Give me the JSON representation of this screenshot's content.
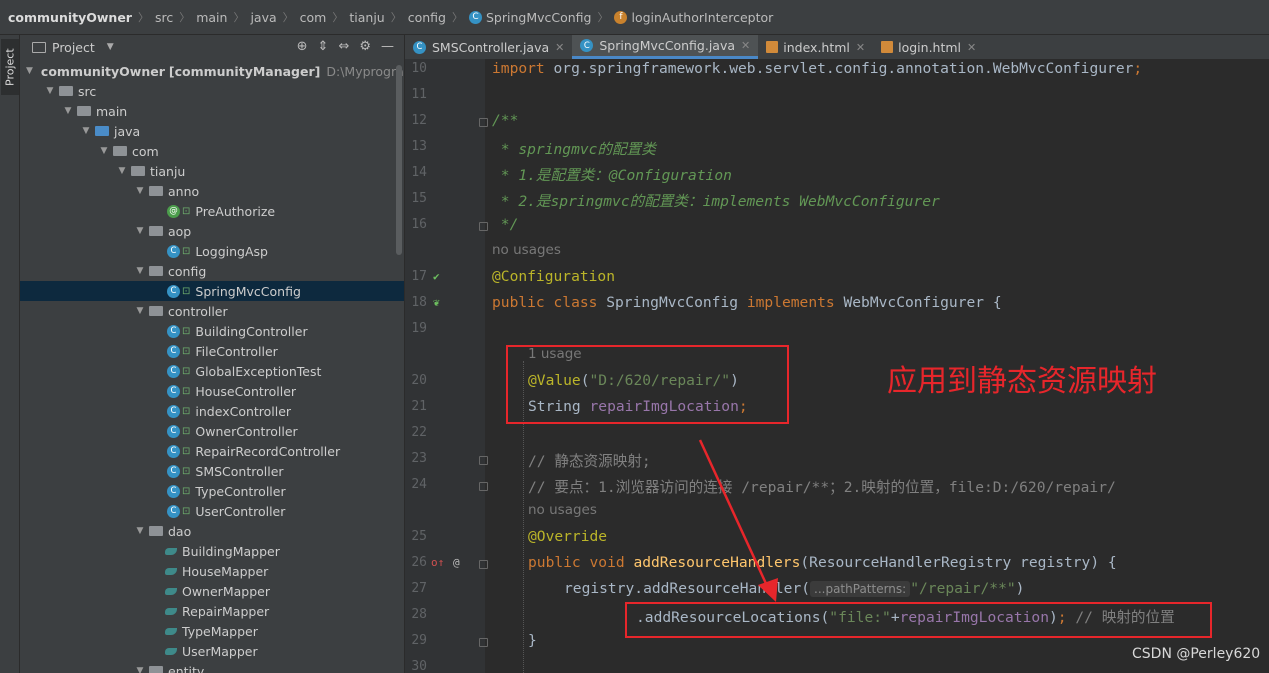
{
  "breadcrumb": {
    "items": [
      "communityOwner",
      "src",
      "main",
      "java",
      "com",
      "tianju",
      "config",
      "SpringMvcConfig",
      "loginAuthorInterceptor"
    ],
    "sep": "〉"
  },
  "toolwindow": {
    "strip_label": "Project"
  },
  "project_panel": {
    "title": "Project",
    "root_name": "communityOwner",
    "root_module": "[communityManager]",
    "root_path": "D:\\Myprogram\\",
    "tree": [
      {
        "label": "src",
        "kind": "folder"
      },
      {
        "label": "main",
        "kind": "folder"
      },
      {
        "label": "java",
        "kind": "folder-blue"
      },
      {
        "label": "com",
        "kind": "folder"
      },
      {
        "label": "tianju",
        "kind": "folder"
      },
      {
        "label": "anno",
        "kind": "folder"
      },
      {
        "label": "PreAuthorize",
        "kind": "annotation"
      },
      {
        "label": "aop",
        "kind": "folder"
      },
      {
        "label": "LoggingAsp",
        "kind": "class"
      },
      {
        "label": "config",
        "kind": "folder"
      },
      {
        "label": "SpringMvcConfig",
        "kind": "class",
        "selected": true
      },
      {
        "label": "controller",
        "kind": "folder"
      },
      {
        "label": "BuildingController",
        "kind": "class"
      },
      {
        "label": "FileController",
        "kind": "class"
      },
      {
        "label": "GlobalExceptionTest",
        "kind": "class"
      },
      {
        "label": "HouseController",
        "kind": "class"
      },
      {
        "label": "indexController",
        "kind": "class"
      },
      {
        "label": "OwnerController",
        "kind": "class"
      },
      {
        "label": "RepairRecordController",
        "kind": "class"
      },
      {
        "label": "SMSController",
        "kind": "class"
      },
      {
        "label": "TypeController",
        "kind": "class"
      },
      {
        "label": "UserController",
        "kind": "class"
      },
      {
        "label": "dao",
        "kind": "folder"
      },
      {
        "label": "BuildingMapper",
        "kind": "mapper"
      },
      {
        "label": "HouseMapper",
        "kind": "mapper"
      },
      {
        "label": "OwnerMapper",
        "kind": "mapper"
      },
      {
        "label": "RepairMapper",
        "kind": "mapper"
      },
      {
        "label": "TypeMapper",
        "kind": "mapper"
      },
      {
        "label": "UserMapper",
        "kind": "mapper"
      },
      {
        "label": "entity",
        "kind": "folder"
      }
    ]
  },
  "tabs": [
    {
      "label": "SMSController.java",
      "icon": "class-icon",
      "active": false
    },
    {
      "label": "SpringMvcConfig.java",
      "icon": "class-icon",
      "active": true
    },
    {
      "label": "index.html",
      "icon": "html-icon",
      "active": false
    },
    {
      "label": "login.html",
      "icon": "html-icon",
      "active": false
    }
  ],
  "editor": {
    "lines": {
      "l10": {
        "num": "10",
        "import_kw": "import",
        "text": " org.springframework.web.servlet.config.annotation.WebMvcConfigurer",
        "semi": ";"
      },
      "l11": {
        "num": "11"
      },
      "l12": {
        "num": "12",
        "text": "/**"
      },
      "l13": {
        "num": "13",
        "text": " * springmvc的配置类"
      },
      "l14": {
        "num": "14",
        "text": " * 1.是配置类：@Configuration"
      },
      "l15": {
        "num": "15",
        "text": " * 2.是springmvc的配置类：implements WebMvcConfigurer"
      },
      "l16": {
        "num": "16",
        "text": " */"
      },
      "hint1": "no usages",
      "l17": {
        "num": "17",
        "text": "@Configuration"
      },
      "l18": {
        "num": "18",
        "kw1": "public class",
        "name": " SpringMvcConfig ",
        "kw2": "implements",
        "rest": " WebMvcConfigurer {"
      },
      "l19": {
        "num": "19"
      },
      "hint2": "1 usage",
      "l20": {
        "num": "20",
        "ann": "@Value",
        "open": "(",
        "str": "\"D:/620/repair/\"",
        "close": ")"
      },
      "l21": {
        "num": "21",
        "type": "String ",
        "field": "repairImgLocation",
        "semi": ";"
      },
      "l22": {
        "num": "22"
      },
      "l23": {
        "num": "23",
        "text": "// 静态资源映射;"
      },
      "l24": {
        "num": "24",
        "text": "// 要点：1.浏览器访问的连接 /repair/**；2.映射的位置，file:D:/620/repair/"
      },
      "hint3": "no usages",
      "l25": {
        "num": "25",
        "text": "@Override"
      },
      "l26": {
        "num": "26",
        "kw": "public void",
        "fn": " addResourceHandlers",
        "rest": "(ResourceHandlerRegistry registry) {"
      },
      "l27": {
        "num": "27",
        "pre": "registry.addResourceHandler(",
        "param_hint": "...pathPatterns:",
        "str": "\"/repair/**\"",
        "post": ")"
      },
      "l28": {
        "num": "28",
        "pre": ".addResourceLocations(",
        "str": "\"file:\"",
        "plus": "+",
        "field": "repairImgLocation",
        "post": ")",
        "semi": ";",
        "comment": " // 映射的位置"
      },
      "l29": {
        "num": "29",
        "text": "}"
      },
      "l30": {
        "num": "30"
      }
    }
  },
  "annotation_note": "应用到静态资源映射",
  "watermark": "CSDN @Perley620",
  "colors": {
    "highlight": "#e7262b",
    "keyword": "#cc7832",
    "string": "#6a8759",
    "field": "#9876aa",
    "annotation": "#bbb529"
  }
}
